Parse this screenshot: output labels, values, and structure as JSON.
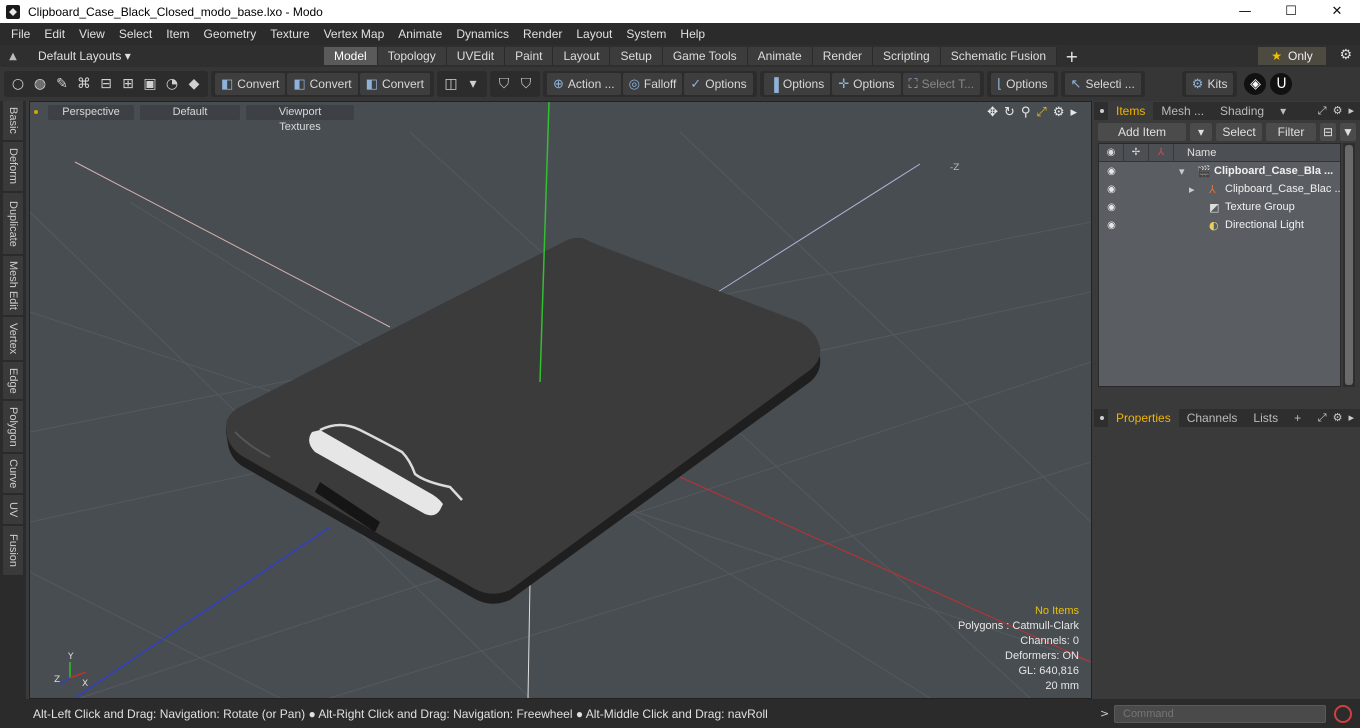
{
  "window": {
    "title": "Clipboard_Case_Black_Closed_modo_base.lxo - Modo",
    "minimize": "—",
    "maximize": "☐",
    "close": "✕"
  },
  "menu": [
    "File",
    "Edit",
    "View",
    "Select",
    "Item",
    "Geometry",
    "Texture",
    "Vertex Map",
    "Animate",
    "Dynamics",
    "Render",
    "Layout",
    "System",
    "Help"
  ],
  "layoutbar": {
    "layouts_label": "Default Layouts ▾",
    "tabs": [
      "Model",
      "Topology",
      "UVEdit",
      "Paint",
      "Layout",
      "Setup",
      "Game Tools",
      "Animate",
      "Render",
      "Scripting",
      "Schematic Fusion"
    ],
    "active_tab": "Model",
    "add": "+",
    "only_label": "Only"
  },
  "toolbar": {
    "convert_1": "Convert",
    "convert_2": "Convert",
    "convert_3": "Convert",
    "action": "Action ...",
    "falloff": "Falloff",
    "options_1": "Options",
    "options_2": "Options",
    "options_3": "Options",
    "select_t": "Select T...",
    "options_4": "Options",
    "selecti": "Selecti ...",
    "kits": "Kits"
  },
  "left_tabs": [
    "Basic",
    "Deform",
    "Duplicate",
    "Mesh Edit",
    "Vertex",
    "Edge",
    "Polygon",
    "Curve",
    "UV",
    "Fusion"
  ],
  "viewport": {
    "view_mode": "Perspective",
    "shading": "Default",
    "textures": "Viewport Textures",
    "neg_z_label": "-Z",
    "info": {
      "selection": "No Items",
      "polygons": "Polygons : Catmull-Clark",
      "channels": "Channels: 0",
      "deformers": "Deformers: ON",
      "gl": "GL: 640,816",
      "scale": "20 mm"
    },
    "gizmo": {
      "y": "Y",
      "x": "X",
      "z": "Z"
    }
  },
  "items_panel": {
    "tabs": [
      "Items",
      "Mesh ...",
      "Shading"
    ],
    "active_tab": "Items",
    "add_item": "Add Item",
    "select": "Select",
    "filter": "Filter",
    "name_header": "Name",
    "items": [
      {
        "label": "Clipboard_Case_Bla ...",
        "bold": true
      },
      {
        "label": "Clipboard_Case_Blac ...",
        "bold": false
      },
      {
        "label": "Texture Group",
        "bold": false
      },
      {
        "label": "Directional Light",
        "bold": false
      }
    ]
  },
  "properties_panel": {
    "tabs": [
      "Properties",
      "Channels",
      "Lists"
    ],
    "active_tab": "Properties",
    "add": "+"
  },
  "statusbar": {
    "text": "Alt-Left Click and Drag: Navigation: Rotate (or Pan) ● Alt-Right Click and Drag: Navigation: Freewheel ● Alt-Middle Click and Drag: navRoll"
  },
  "command": {
    "placeholder": "Command",
    "arrow": ">"
  },
  "colors": {
    "accent": "#f0b400",
    "viewport_bg": "#484d52",
    "axis_x": "#c03030",
    "axis_y": "#30c030",
    "axis_z": "#3040c0"
  }
}
